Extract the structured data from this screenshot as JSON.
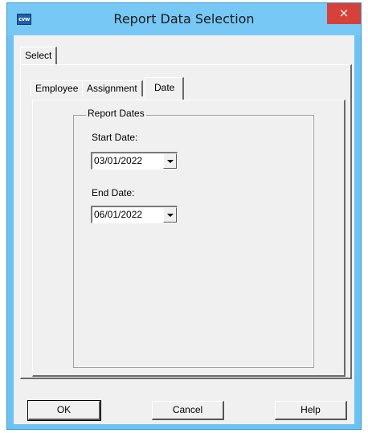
{
  "window": {
    "title": "Report Data Selection",
    "app_icon_text": "cvw",
    "close_symbol": "×",
    "titlebar_color": "#77c8f5",
    "close_color": "#d6413a"
  },
  "outer_tabs": [
    {
      "label": "Select",
      "selected": true
    }
  ],
  "inner_tabs": [
    {
      "label": "Employee",
      "selected": false
    },
    {
      "label": "Assignment",
      "selected": false
    },
    {
      "label": "Date",
      "selected": true
    }
  ],
  "report_dates": {
    "group_label": "Report Dates",
    "start_label": "Start Date:",
    "start_value": "03/01/2022",
    "end_label": "End Date:",
    "end_value": "06/01/2022"
  },
  "buttons": {
    "ok": "OK",
    "cancel": "Cancel",
    "help": "Help"
  }
}
